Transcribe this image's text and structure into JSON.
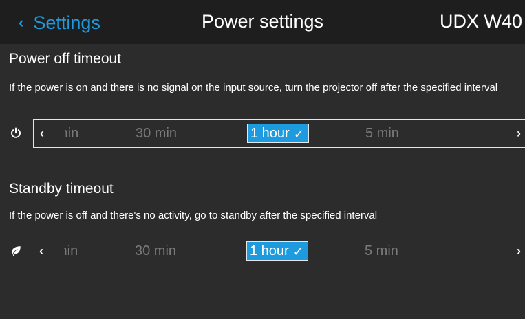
{
  "header": {
    "back_label": "Settings",
    "title": "Power settings",
    "device": "UDX W40"
  },
  "power_off": {
    "title": "Power off timeout",
    "description": "If the power is on and there is no signal on the input source, turn the projector off after the specified interval",
    "icon": "power-icon",
    "options_visible": [
      "min",
      "30 min",
      "1 hour",
      "5 min"
    ],
    "partial_option": "min",
    "option_2": "30 min",
    "selected": "1 hour",
    "option_4": "5 min"
  },
  "standby": {
    "title": "Standby timeout",
    "description": "If the power is off and there's no activity, go to standby after the specified interval",
    "icon": "leaf-icon",
    "options_visible": [
      "min",
      "30 min",
      "1 hour",
      "5 min"
    ],
    "partial_option": "min",
    "option_2": "30 min",
    "selected": "1 hour",
    "option_4": "5 min"
  },
  "colors": {
    "accent": "#1e9bde",
    "background": "#2c2c2c",
    "header_background": "#1e1e1e",
    "unselected_text": "#7a7a7a"
  }
}
